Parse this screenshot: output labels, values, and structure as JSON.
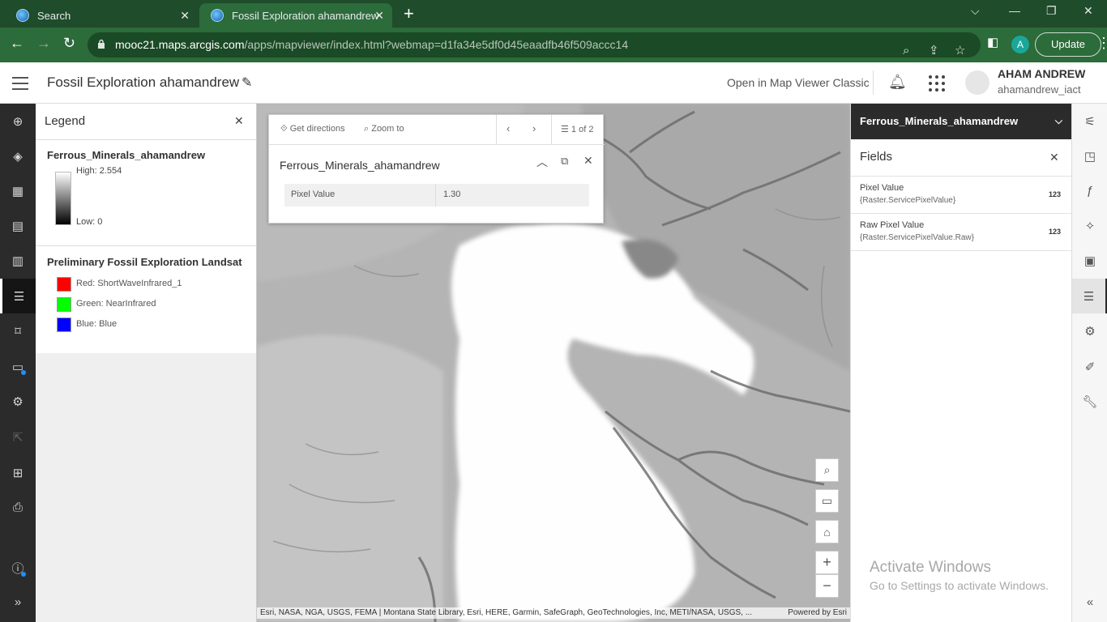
{
  "browser": {
    "tabs": [
      {
        "title": "Search"
      },
      {
        "title": "Fossil Exploration ahamandrew"
      }
    ],
    "url_host": "mooc21.maps.arcgis.com",
    "url_path": "/apps/mapviewer/index.html?webmap=d1fa34e5df0d45eaadfb46f509accc14",
    "profile_initial": "A",
    "update_label": "Update"
  },
  "header": {
    "map_title": "Fossil Exploration ahamandrew",
    "open_classic": "Open in Map Viewer Classic",
    "user_name": "AHAM ANDREW",
    "user_id": "ahamandrew_iact"
  },
  "left_toolbar": {
    "icons": [
      "add-icon",
      "layers-icon",
      "tables-icon",
      "basemap-icon",
      "charts-icon",
      "legend-icon",
      "bookmarks-icon",
      "save-icon",
      "settings-icon",
      "share-icon",
      "apps-icon",
      "print-icon",
      "info-icon",
      "expand-icon"
    ],
    "active": "legend-icon"
  },
  "legend": {
    "title": "Legend",
    "layer1": {
      "name": "Ferrous_Minerals_ahamandrew",
      "high": "High: 2.554",
      "low": "Low: 0"
    },
    "layer2": {
      "name": "Preliminary Fossil Exploration Landsat",
      "items": [
        {
          "label": "Red: ShortWaveInfrared_1",
          "color": "#ff0000"
        },
        {
          "label": "Green: NearInfrared",
          "color": "#00ff00"
        },
        {
          "label": "Blue: Blue",
          "color": "#0000ff"
        }
      ]
    }
  },
  "popup": {
    "get_directions": "Get directions",
    "zoom_to": "Zoom to",
    "pager": "1 of 2",
    "title": "Ferrous_Minerals_ahamandrew",
    "field_name": "Pixel Value",
    "field_value": "1.30"
  },
  "map": {
    "attribution": "Esri, NASA, NGA, USGS, FEMA | Montana State Library, Esri, HERE, Garmin, SafeGraph, GeoTechnologies, Inc, METI/NASA, USGS, ...",
    "powered_by": "Powered by Esri"
  },
  "fields_panel": {
    "layer": "Ferrous_Minerals_ahamandrew",
    "title": "Fields",
    "fields": [
      {
        "name": "Pixel Value",
        "expr": "{Raster.ServicePixelValue}",
        "type": "123"
      },
      {
        "name": "Raw Pixel Value",
        "expr": "{Raster.ServicePixelValue.Raw}",
        "type": "123"
      }
    ]
  },
  "watermark": {
    "line1": "Activate Windows",
    "line2": "Go to Settings to activate Windows."
  }
}
